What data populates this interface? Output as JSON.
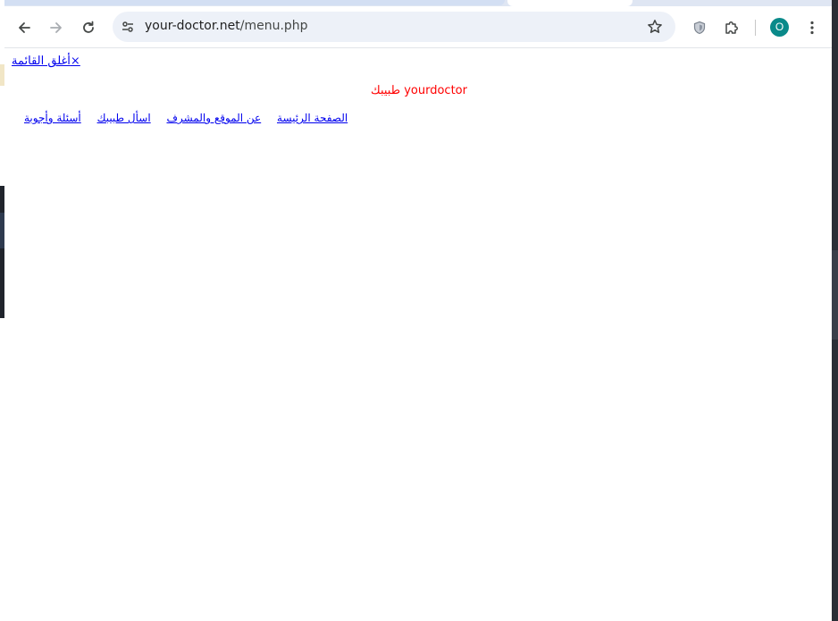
{
  "browser": {
    "url_host": "your-doctor.net",
    "url_path": "/menu.php",
    "profile_initial": "O",
    "accent_color": "#0a8a8a"
  },
  "icons": {
    "back": "back-arrow-icon",
    "forward": "forward-arrow-icon",
    "reload": "reload-icon",
    "site_info": "tune-icon",
    "bookmark": "star-icon",
    "shield": "shield-icon",
    "extensions": "puzzle-icon",
    "menu": "kebab-menu-icon"
  },
  "page": {
    "close_menu": "أغلق القائمة×",
    "brand": {
      "arabic": "طبيبك",
      "latin": "yourdoctor",
      "color": "#ff0000"
    },
    "nav": [
      {
        "label": "الصفحة الرئيسة"
      },
      {
        "label": "عن الموقع والمشرف"
      },
      {
        "label": "اسأل طبيبك"
      },
      {
        "label": "أسئلة وأجوبة"
      }
    ]
  }
}
